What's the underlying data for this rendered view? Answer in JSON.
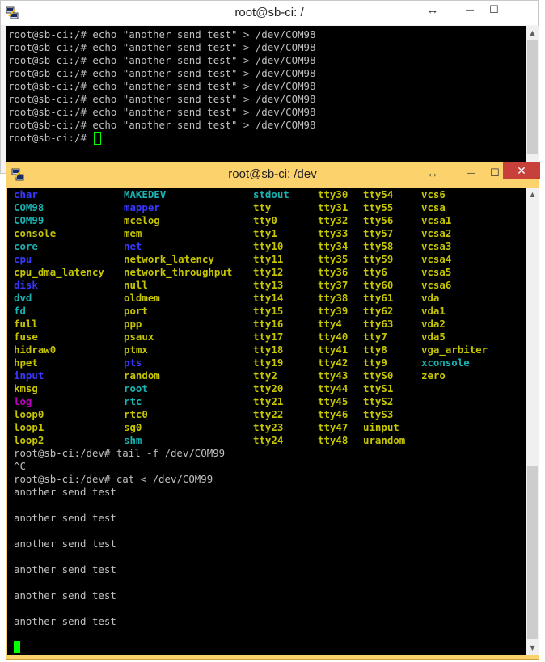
{
  "window_back": {
    "title": "root@sb-ci: /",
    "lines": [
      "root@sb-ci:/# echo \"another send test\" > /dev/COM98",
      "root@sb-ci:/# echo \"another send test\" > /dev/COM98",
      "root@sb-ci:/# echo \"another send test\" > /dev/COM98",
      "root@sb-ci:/# echo \"another send test\" > /dev/COM98",
      "root@sb-ci:/# echo \"another send test\" > /dev/COM98",
      "root@sb-ci:/# echo \"another send test\" > /dev/COM98",
      "root@sb-ci:/# echo \"another send test\" > /dev/COM98",
      "root@sb-ci:/# echo \"another send test\" > /dev/COM98",
      "root@sb-ci:/# "
    ],
    "controls": {
      "resize": "↔",
      "minimize": "—",
      "maximize": "☐"
    }
  },
  "window_front": {
    "title": "root@sb-ci: /dev",
    "controls": {
      "resize": "↔",
      "minimize": "—",
      "maximize": "☐",
      "close": "✕"
    },
    "colors": {
      "title_bg": "#fbd26b",
      "close_bg": "#c7413a",
      "cursor": "#00ff00"
    },
    "listing": {
      "columns": [
        [
          {
            "t": "char",
            "c": "dir"
          },
          {
            "t": "COM98",
            "c": "cyan"
          },
          {
            "t": "COM99",
            "c": "cyan"
          },
          {
            "t": "console",
            "c": "yel"
          },
          {
            "t": "core",
            "c": "cyan"
          },
          {
            "t": "cpu",
            "c": "dir"
          },
          {
            "t": "cpu_dma_latency",
            "c": "yel"
          },
          {
            "t": "disk",
            "c": "dir"
          },
          {
            "t": "dvd",
            "c": "cyan"
          },
          {
            "t": "fd",
            "c": "cyan"
          },
          {
            "t": "full",
            "c": "yel"
          },
          {
            "t": "fuse",
            "c": "yel"
          },
          {
            "t": "hidraw0",
            "c": "yel"
          },
          {
            "t": "hpet",
            "c": "yel"
          },
          {
            "t": "input",
            "c": "dir"
          },
          {
            "t": "kmsg",
            "c": "yel"
          },
          {
            "t": "log",
            "c": "mag"
          },
          {
            "t": "loop0",
            "c": "yel"
          },
          {
            "t": "loop1",
            "c": "yel"
          },
          {
            "t": "loop2",
            "c": "yel"
          }
        ],
        [
          {
            "t": "MAKEDEV",
            "c": "cyan"
          },
          {
            "t": "mapper",
            "c": "dir"
          },
          {
            "t": "mcelog",
            "c": "yel"
          },
          {
            "t": "mem",
            "c": "yel"
          },
          {
            "t": "net",
            "c": "dir"
          },
          {
            "t": "network_latency",
            "c": "yel"
          },
          {
            "t": "network_throughput",
            "c": "yel"
          },
          {
            "t": "null",
            "c": "yel"
          },
          {
            "t": "oldmem",
            "c": "yel"
          },
          {
            "t": "port",
            "c": "yel"
          },
          {
            "t": "ppp",
            "c": "yel"
          },
          {
            "t": "psaux",
            "c": "yel"
          },
          {
            "t": "ptmx",
            "c": "yel"
          },
          {
            "t": "pts",
            "c": "dir"
          },
          {
            "t": "random",
            "c": "yel"
          },
          {
            "t": "root",
            "c": "cyan"
          },
          {
            "t": "rtc",
            "c": "cyan"
          },
          {
            "t": "rtc0",
            "c": "yel"
          },
          {
            "t": "sg0",
            "c": "yel"
          },
          {
            "t": "shm",
            "c": "cyan"
          }
        ],
        [
          {
            "t": "stdout",
            "c": "cyan"
          },
          {
            "t": "tty",
            "c": "yel"
          },
          {
            "t": "tty0",
            "c": "yel"
          },
          {
            "t": "tty1",
            "c": "yel"
          },
          {
            "t": "tty10",
            "c": "yel"
          },
          {
            "t": "tty11",
            "c": "yel"
          },
          {
            "t": "tty12",
            "c": "yel"
          },
          {
            "t": "tty13",
            "c": "yel"
          },
          {
            "t": "tty14",
            "c": "yel"
          },
          {
            "t": "tty15",
            "c": "yel"
          },
          {
            "t": "tty16",
            "c": "yel"
          },
          {
            "t": "tty17",
            "c": "yel"
          },
          {
            "t": "tty18",
            "c": "yel"
          },
          {
            "t": "tty19",
            "c": "yel"
          },
          {
            "t": "tty2",
            "c": "yel"
          },
          {
            "t": "tty20",
            "c": "yel"
          },
          {
            "t": "tty21",
            "c": "yel"
          },
          {
            "t": "tty22",
            "c": "yel"
          },
          {
            "t": "tty23",
            "c": "yel"
          },
          {
            "t": "tty24",
            "c": "yel"
          }
        ],
        [
          {
            "t": "tty30",
            "c": "yel"
          },
          {
            "t": "tty31",
            "c": "yel"
          },
          {
            "t": "tty32",
            "c": "yel"
          },
          {
            "t": "tty33",
            "c": "yel"
          },
          {
            "t": "tty34",
            "c": "yel"
          },
          {
            "t": "tty35",
            "c": "yel"
          },
          {
            "t": "tty36",
            "c": "yel"
          },
          {
            "t": "tty37",
            "c": "yel"
          },
          {
            "t": "tty38",
            "c": "yel"
          },
          {
            "t": "tty39",
            "c": "yel"
          },
          {
            "t": "tty4",
            "c": "yel"
          },
          {
            "t": "tty40",
            "c": "yel"
          },
          {
            "t": "tty41",
            "c": "yel"
          },
          {
            "t": "tty42",
            "c": "yel"
          },
          {
            "t": "tty43",
            "c": "yel"
          },
          {
            "t": "tty44",
            "c": "yel"
          },
          {
            "t": "tty45",
            "c": "yel"
          },
          {
            "t": "tty46",
            "c": "yel"
          },
          {
            "t": "tty47",
            "c": "yel"
          },
          {
            "t": "tty48",
            "c": "yel"
          }
        ],
        [
          {
            "t": "tty54",
            "c": "yel"
          },
          {
            "t": "tty55",
            "c": "yel"
          },
          {
            "t": "tty56",
            "c": "yel"
          },
          {
            "t": "tty57",
            "c": "yel"
          },
          {
            "t": "tty58",
            "c": "yel"
          },
          {
            "t": "tty59",
            "c": "yel"
          },
          {
            "t": "tty6",
            "c": "yel"
          },
          {
            "t": "tty60",
            "c": "yel"
          },
          {
            "t": "tty61",
            "c": "yel"
          },
          {
            "t": "tty62",
            "c": "yel"
          },
          {
            "t": "tty63",
            "c": "yel"
          },
          {
            "t": "tty7",
            "c": "yel"
          },
          {
            "t": "tty8",
            "c": "yel"
          },
          {
            "t": "tty9",
            "c": "yel"
          },
          {
            "t": "ttyS0",
            "c": "yel"
          },
          {
            "t": "ttyS1",
            "c": "yel"
          },
          {
            "t": "ttyS2",
            "c": "yel"
          },
          {
            "t": "ttyS3",
            "c": "yel"
          },
          {
            "t": "uinput",
            "c": "yel"
          },
          {
            "t": "urandom",
            "c": "yel"
          }
        ],
        [
          {
            "t": "vcs6",
            "c": "yel"
          },
          {
            "t": "vcsa",
            "c": "yel"
          },
          {
            "t": "vcsa1",
            "c": "yel"
          },
          {
            "t": "vcsa2",
            "c": "yel"
          },
          {
            "t": "vcsa3",
            "c": "yel"
          },
          {
            "t": "vcsa4",
            "c": "yel"
          },
          {
            "t": "vcsa5",
            "c": "yel"
          },
          {
            "t": "vcsa6",
            "c": "yel"
          },
          {
            "t": "vda",
            "c": "yel"
          },
          {
            "t": "vda1",
            "c": "yel"
          },
          {
            "t": "vda2",
            "c": "yel"
          },
          {
            "t": "vda5",
            "c": "yel"
          },
          {
            "t": "vga_arbiter",
            "c": "yel"
          },
          {
            "t": "xconsole",
            "c": "cyan"
          },
          {
            "t": "zero",
            "c": "yel"
          }
        ]
      ]
    },
    "output_lines": [
      "root@sb-ci:/dev# tail -f /dev/COM99",
      "^C",
      "root@sb-ci:/dev# cat < /dev/COM99",
      "another send test",
      "",
      "another send test",
      "",
      "another send test",
      "",
      "another send test",
      "",
      "another send test",
      "",
      "another send test",
      "",
      ""
    ],
    "scrollbar": {
      "up": "▲",
      "down": "▼",
      "position_fraction": 0.82
    }
  }
}
